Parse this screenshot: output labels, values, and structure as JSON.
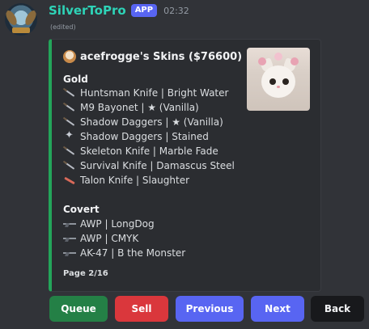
{
  "message": {
    "username": "SilverToPro",
    "badge": "APP",
    "timestamp": "02:32",
    "edited": "(edited)"
  },
  "embed": {
    "accent_color": "#23a55a",
    "author": "acefrogge's Skins ($76600)",
    "sections": [
      {
        "title": "Gold",
        "items": [
          {
            "icon": "knife-icon",
            "text": "Huntsman Knife | Bright Water"
          },
          {
            "icon": "knife-icon",
            "text": "M9 Bayonet | ★ (Vanilla)"
          },
          {
            "icon": "knife-icon",
            "text": "Shadow Daggers | ★ (Vanilla)"
          },
          {
            "icon": "butterfly-icon",
            "text": "Shadow Daggers | Stained"
          },
          {
            "icon": "knife-icon",
            "text": "Skeleton Knife | Marble Fade"
          },
          {
            "icon": "knife-icon",
            "text": "Survival Knife | Damascus Steel"
          },
          {
            "icon": "red-knife-icon",
            "text": "Talon Knife | Slaughter"
          }
        ]
      },
      {
        "title": "Covert",
        "items": [
          {
            "icon": "rifle-icon",
            "text": "AWP | LongDog"
          },
          {
            "icon": "rifle-icon",
            "text": "AWP | CMYK"
          },
          {
            "icon": "rifle-icon",
            "text": "AK-47 | B the Monster"
          }
        ]
      }
    ],
    "footer": "Page 2/16"
  },
  "buttons": {
    "queue": "Queue",
    "sell": "Sell",
    "previous": "Previous",
    "next": "Next",
    "back": "Back"
  }
}
